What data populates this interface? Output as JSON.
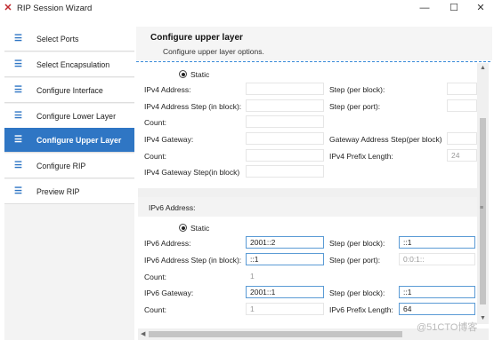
{
  "window": {
    "title": "RIP Session Wizard",
    "app_icon": "x-logo-icon",
    "minimize": "—",
    "maximize": "☐",
    "close": "✕"
  },
  "sidebar": {
    "items": [
      {
        "label": "Select Ports",
        "icon": "list-icon"
      },
      {
        "label": "Select Encapsulation",
        "icon": "list-icon"
      },
      {
        "label": "Configure Interface",
        "icon": "list-icon"
      },
      {
        "label": "Configure Lower Layer",
        "icon": "list-icon"
      },
      {
        "label": "Configure Upper Layer",
        "icon": "list-icon",
        "active": true
      },
      {
        "label": "Configure RIP",
        "icon": "list-icon"
      },
      {
        "label": "Preview RIP",
        "icon": "list-icon"
      }
    ]
  },
  "header": {
    "title": "Configure upper layer",
    "subtitle": "Configure upper layer options."
  },
  "ipv4": {
    "static_label": "Static",
    "address_label": "IPv4 Address:",
    "address_value": "",
    "address_step_label": "IPv4 Address Step (in block):",
    "address_step_value": "",
    "count_label": "Count:",
    "count_value": "",
    "gateway_label": "IPv4 Gateway:",
    "gateway_value": "",
    "count2_label": "Count:",
    "count2_value": "",
    "gateway_step_label": "IPv4 Gateway Step(in block)",
    "gateway_step_value": "",
    "step_block_label": "Step (per block):",
    "step_block_value": "",
    "step_port_label": "Step (per port):",
    "step_port_value": "",
    "gw_step_block_label": "Gateway Address Step(per block)",
    "gw_step_block_value": "",
    "prefix_label": "IPv4 Prefix Length:",
    "prefix_value": "24"
  },
  "ipv6": {
    "section_label": "IPv6 Address:",
    "static_label": "Static",
    "address_label": "IPv6 Address:",
    "address_value": "2001::2",
    "address_step_label": "IPv6 Address Step (in block):",
    "address_step_value": "::1",
    "count_label": "Count:",
    "count_value": "1",
    "gateway_label": "IPv6 Gateway:",
    "gateway_value": "2001::1",
    "count2_label": "Count:",
    "count2_value": "1",
    "step_block_label": "Step (per block):",
    "step_block_value": "::1",
    "step_port_label": "Step (per port):",
    "step_port_value": "0:0:1::",
    "gw_step_block_label": "Step (per block):",
    "gw_step_block_value": "::1",
    "prefix_label": "IPv6 Prefix Length:",
    "prefix_value": "64"
  },
  "watermark": "@51CTO博客"
}
